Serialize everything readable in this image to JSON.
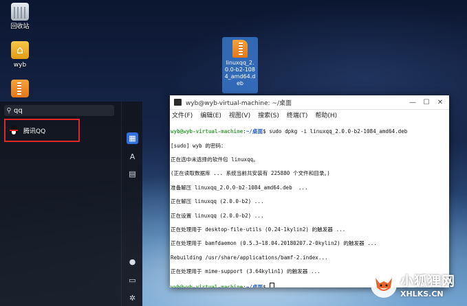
{
  "desktop": {
    "icons": [
      {
        "label": "回收站",
        "icon": "trash-icon"
      },
      {
        "label": "wyb",
        "icon": "home-folder-icon"
      },
      {
        "label": "",
        "icon": "deb-package-icon"
      }
    ],
    "selected_file": {
      "label": "linuxqq_2.0.0-b2-1084_amd64.deb",
      "icon": "deb-package-icon"
    }
  },
  "launcher": {
    "search": {
      "value": "qq",
      "icon": "search-icon"
    },
    "results": [
      {
        "label": "腾讯QQ",
        "icon": "qq-penguin-icon"
      }
    ],
    "strip_icons": [
      "grid-view-icon",
      "letter-sort-icon",
      "category-icon",
      "user-icon",
      "monitor-icon",
      "settings-icon"
    ],
    "accent": "#2f6fde",
    "highlight_color": "#e0282c"
  },
  "terminal": {
    "title": "wyb@wyb-virtual-machine: ~/桌面",
    "menus": [
      "文件(F)",
      "编辑(E)",
      "视图(V)",
      "搜索(S)",
      "终端(T)",
      "帮助(H)"
    ],
    "prompt_user": "wyb@wyb-virtual-machine",
    "prompt_path": "~/桌面",
    "command": "$ sudo dpkg -i linuxqq_2.0.0-b2-1084_amd64.deb",
    "output": [
      "[sudo] wyb 的密码：",
      "正在选中未选择的软件包 linuxqq。",
      "(正在读取数据库 ... 系统当前共安装有 225880 个文件和目录。)",
      "准备解压 linuxqq_2.0.0-b2-1084_amd64.deb  ...",
      "正在解压 linuxqq (2.0.0-b2) ...",
      "正在设置 linuxqq (2.0.0-b2) ...",
      "正在处理用于 desktop-file-utils (0.24-1kylin2) 的触发器 ...",
      "正在处理用于 bamfdaemon (0.5.3~18.04.20180207.2-0kylin2) 的触发器 ...",
      "Rebuilding /usr/share/applications/bamf-2.index...",
      "正在处理用于 mime-support (3.64kylin1) 的触发器 ..."
    ],
    "final_prompt": "$ ",
    "prompt_color": "#3fa33c",
    "path_color": "#2b62c2"
  },
  "watermark": {
    "title": "小狐狸网",
    "url": "XHLKS.CN"
  }
}
